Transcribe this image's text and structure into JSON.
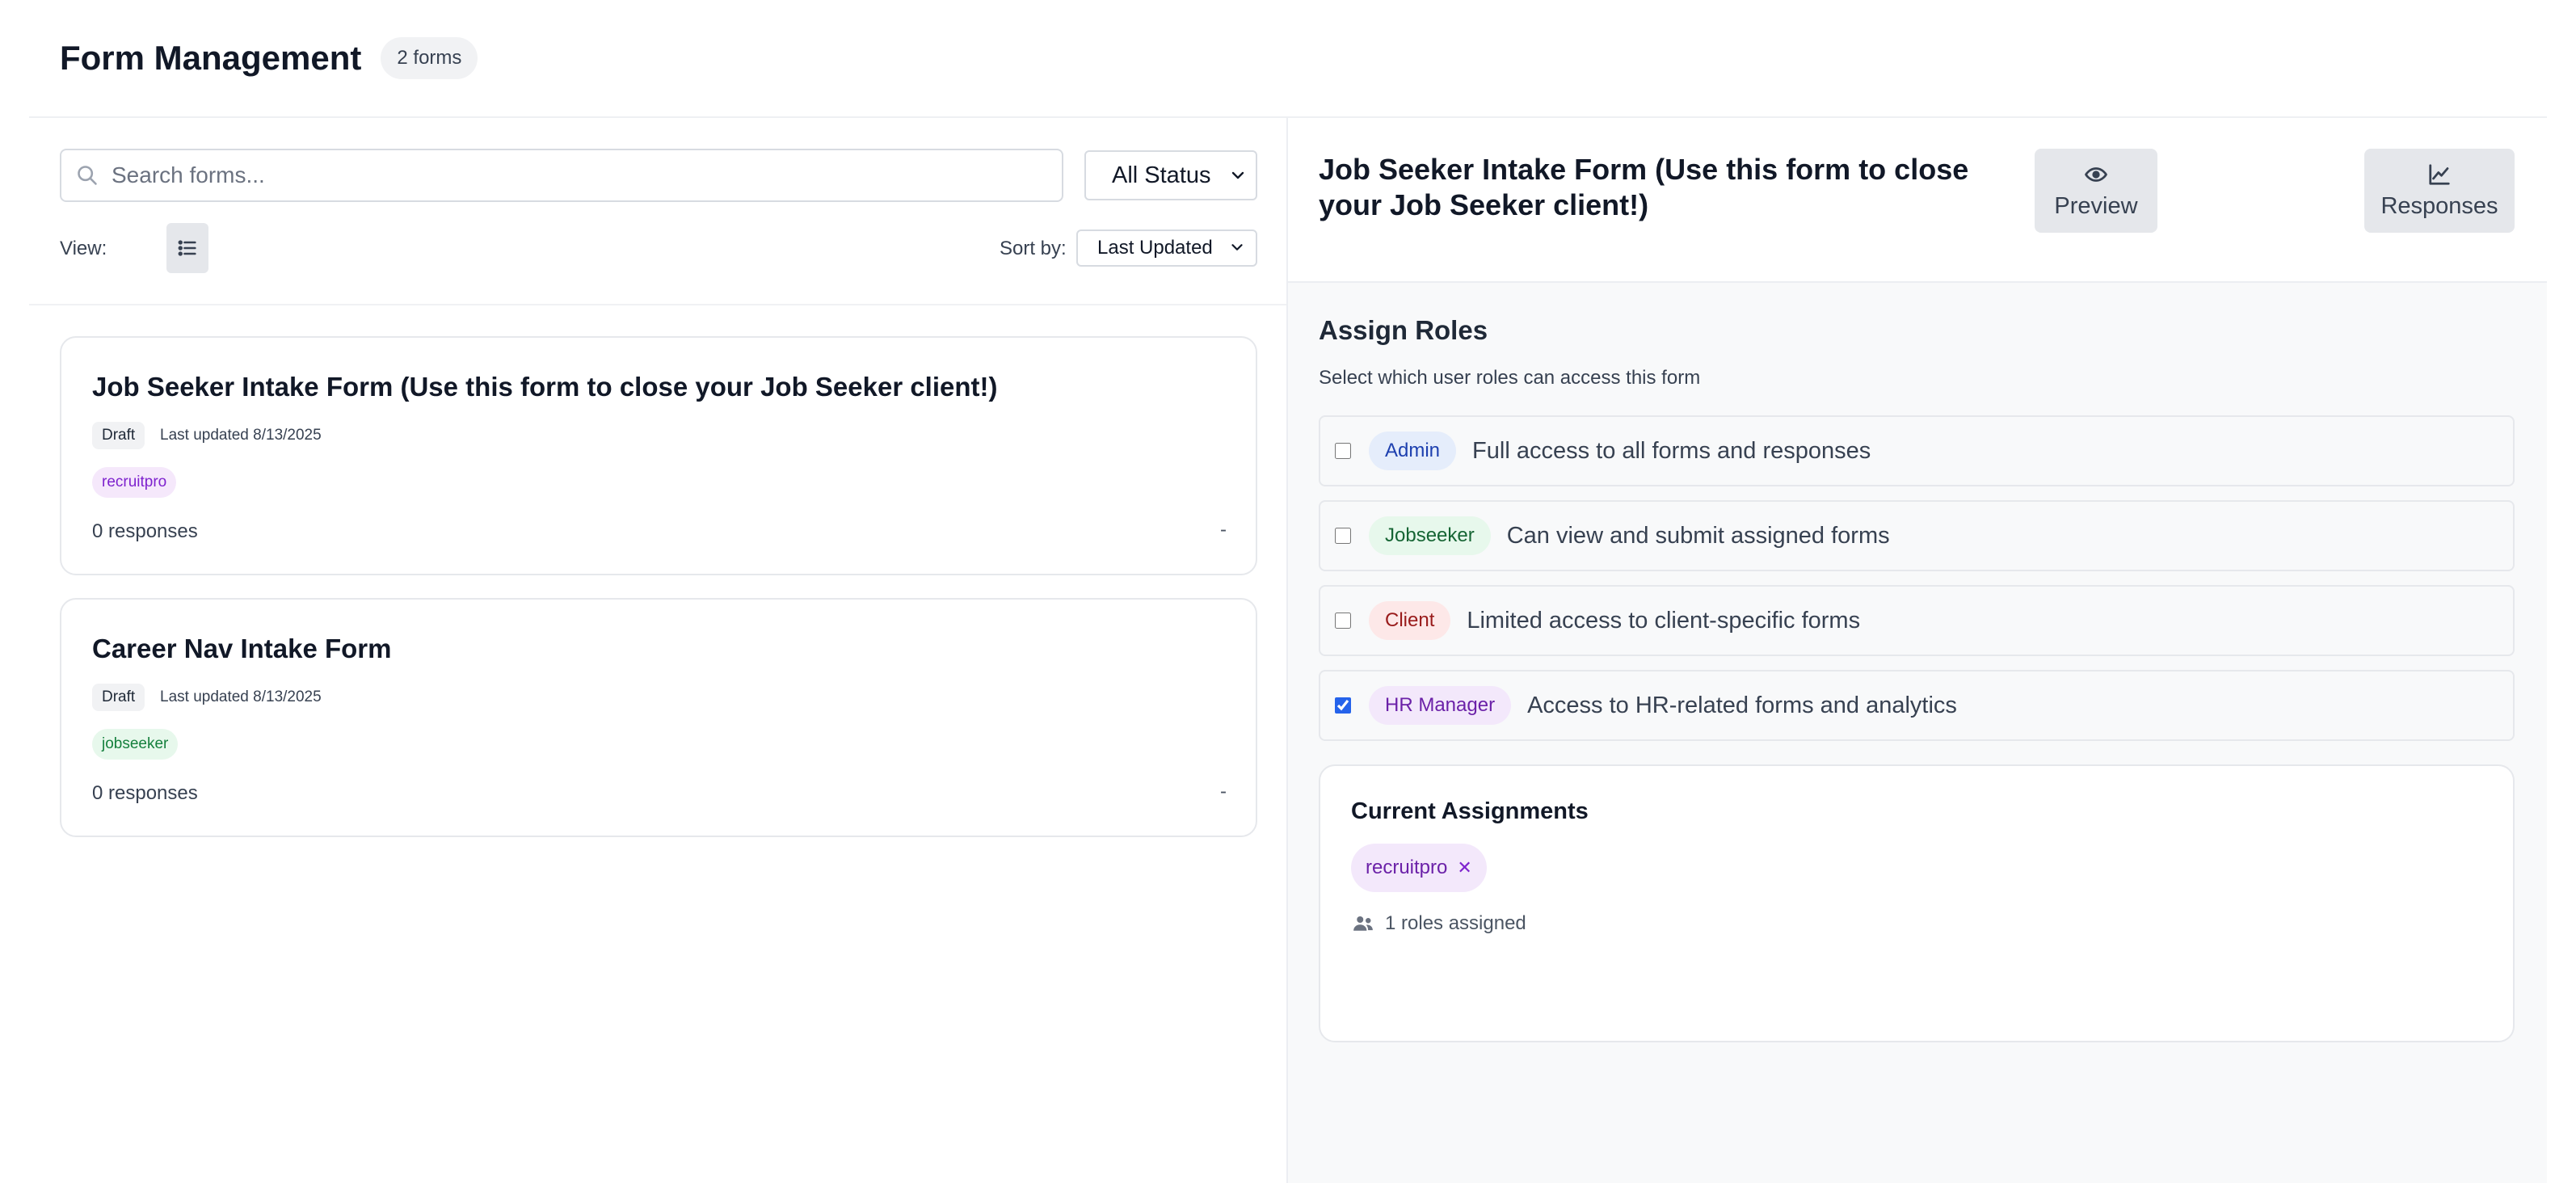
{
  "header": {
    "title": "Form Management",
    "count_badge": "2 forms"
  },
  "toolbar": {
    "search_placeholder": "Search forms...",
    "status_filter": "All Status",
    "view_label": "View:",
    "sort_label": "Sort by:",
    "sort_value": "Last Updated"
  },
  "forms": [
    {
      "title": "Job Seeker Intake Form (Use this form to close your Job Seeker client!)",
      "status": "Draft",
      "updated": "Last updated 8/13/2025",
      "role": "recruitpro",
      "responses": "0 responses",
      "dash": "-"
    },
    {
      "title": "Career Nav Intake Form",
      "status": "Draft",
      "updated": "Last updated 8/13/2025",
      "role": "jobseeker",
      "responses": "0 responses",
      "dash": "-"
    }
  ],
  "detail": {
    "title": "Job Seeker Intake Form (Use this form to close your Job Seeker client!)",
    "preview_label": "Preview",
    "responses_label": "Responses",
    "assign_title": "Assign Roles",
    "assign_subtitle": "Select which user roles can access this form",
    "roles": [
      {
        "name": "Admin",
        "description": "Full access to all forms and responses",
        "checked": false
      },
      {
        "name": "Jobseeker",
        "description": "Can view and submit assigned forms",
        "checked": false
      },
      {
        "name": "Client",
        "description": "Limited access to client-specific forms",
        "checked": false
      },
      {
        "name": "HR Manager",
        "description": "Access to HR-related forms and analytics",
        "checked": true
      }
    ],
    "current": {
      "title": "Current Assignments",
      "tag": "recruitpro",
      "remove_glyph": "✕",
      "summary": "1 roles assigned"
    }
  },
  "icons": {
    "search": "search-icon",
    "chevron": "chevron-down-icon",
    "list_view": "list-icon",
    "preview": "eye-icon",
    "responses": "line-chart-icon",
    "users": "users-icon"
  }
}
